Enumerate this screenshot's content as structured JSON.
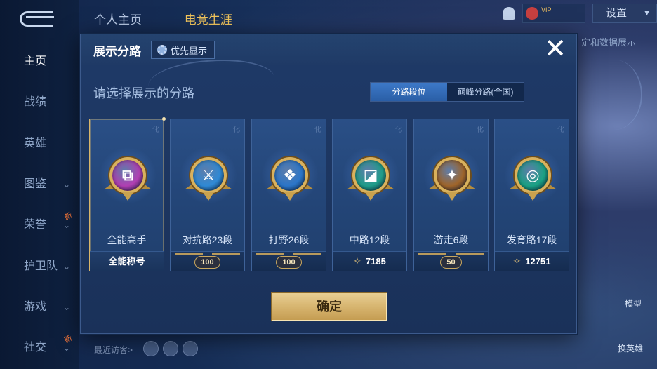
{
  "left_nav": {
    "items": [
      {
        "label": "主页",
        "active": true
      },
      {
        "label": "战绩"
      },
      {
        "label": "英雄"
      },
      {
        "label": "图鉴",
        "has_chevron": true
      },
      {
        "label": "荣誉",
        "has_chevron": true,
        "new_tag": "新"
      },
      {
        "label": "护卫队",
        "has_chevron": true
      },
      {
        "label": "游戏",
        "has_chevron": true
      },
      {
        "label": "社交",
        "has_chevron": true,
        "new_tag": "新"
      }
    ]
  },
  "top_tabs": [
    "个人主页",
    "电竞生涯"
  ],
  "top_right": {
    "settings_label": "设置",
    "vip_text": "VIP"
  },
  "right_side": {
    "info_text": "定和数据展示",
    "model_label": "模型",
    "switch_hero_label": "换英雄"
  },
  "visitors_label": "最近访客>",
  "modal": {
    "title": "展示分路",
    "priority_label": "优先显示",
    "close_icon": "✕",
    "subtitle": "请选择展示的分路",
    "toggle": [
      {
        "label": "分路段位",
        "active": true
      },
      {
        "label": "巅峰分路(全国)",
        "active": false
      }
    ],
    "cards": [
      {
        "label": "全能高手",
        "footer_text": "全能称号",
        "footer_type": "text",
        "emblem_color": "#b23fb3",
        "emblem_glyph": "⧉",
        "selected": true,
        "watermark": "化"
      },
      {
        "label": "对抗路23段",
        "footer_text": "100",
        "footer_type": "badge",
        "emblem_color": "#2f8ad6",
        "emblem_glyph": "⚔",
        "selected": false,
        "watermark": "化"
      },
      {
        "label": "打野26段",
        "footer_text": "100",
        "footer_type": "badge",
        "emblem_color": "#2b76c9",
        "emblem_glyph": "❖",
        "selected": false,
        "watermark": "化"
      },
      {
        "label": "中路12段",
        "footer_text": "7185",
        "footer_type": "score",
        "emblem_color": "#1f9e8a",
        "emblem_glyph": "◪",
        "selected": false,
        "watermark": "化"
      },
      {
        "label": "游走6段",
        "footer_text": "50",
        "footer_type": "badge",
        "emblem_color": "#a0652a",
        "emblem_glyph": "✦",
        "selected": false,
        "watermark": "化"
      },
      {
        "label": "发育路17段",
        "footer_text": "12751",
        "footer_type": "score",
        "emblem_color": "#1aa284",
        "emblem_glyph": "◎",
        "selected": false,
        "watermark": "化"
      }
    ],
    "confirm_label": "确定"
  },
  "colors": {
    "accent_gold": "#d9b66a",
    "toggle_active": "#3d79c8",
    "modal_bg": "#1f3a68"
  }
}
